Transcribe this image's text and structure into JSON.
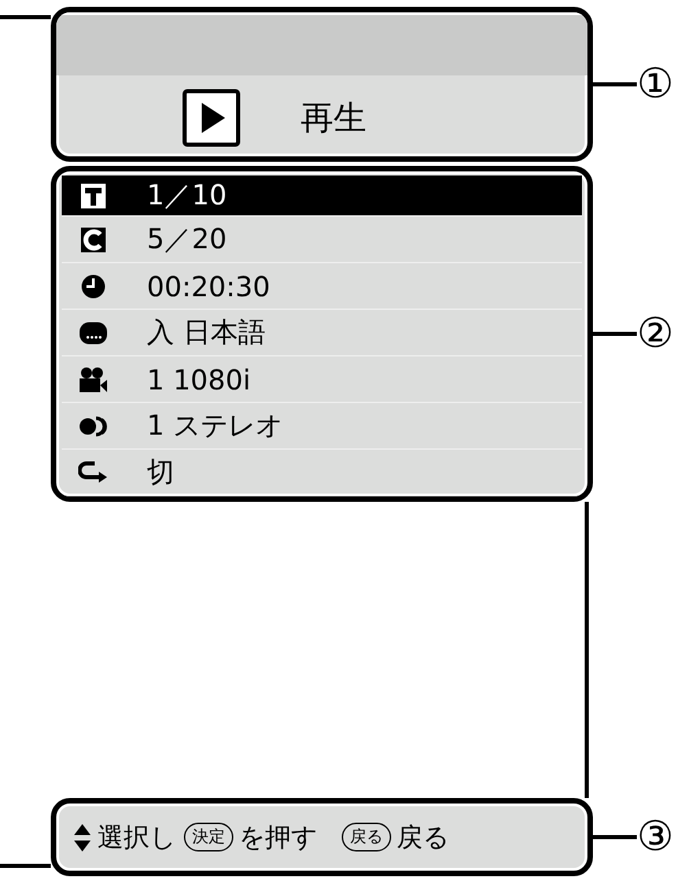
{
  "status": {
    "label": "再生"
  },
  "info_rows": [
    {
      "kind": "title",
      "text": "1／10",
      "selected": true
    },
    {
      "kind": "chapter",
      "text": "5／20",
      "selected": false
    },
    {
      "kind": "time",
      "text": "00:20:30",
      "selected": false
    },
    {
      "kind": "subtitle",
      "text": "入 日本語",
      "selected": false
    },
    {
      "kind": "video",
      "text": "1 1080i",
      "selected": false
    },
    {
      "kind": "audio",
      "text": "1 ステレオ",
      "selected": false
    },
    {
      "kind": "repeat",
      "text": "切",
      "selected": false
    }
  ],
  "guide": [
    {
      "kind": "updown",
      "text": "選択し"
    },
    {
      "kind": "key",
      "key": "決定",
      "text": "を押す"
    },
    {
      "kind": "key",
      "key": "戻る",
      "text": "戻る"
    }
  ],
  "callouts": [
    "①",
    "②",
    "③"
  ]
}
